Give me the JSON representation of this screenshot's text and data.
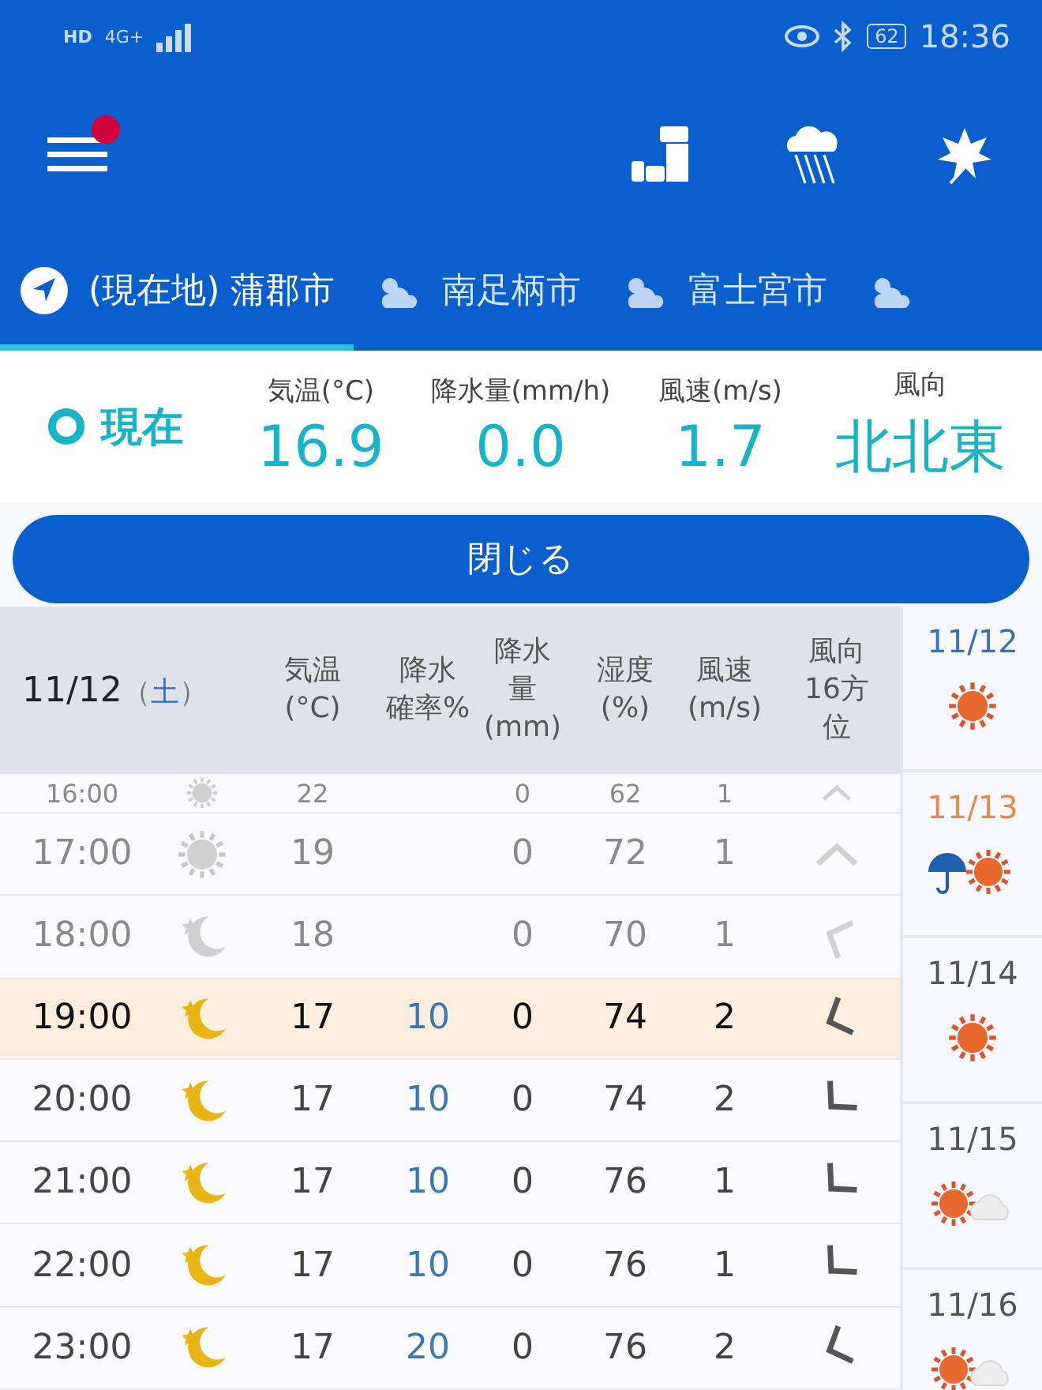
{
  "status_bar": {
    "left": [
      "HD",
      "4G+"
    ],
    "battery": "62",
    "time": "18:36"
  },
  "toolbar": {
    "menu_badge": true
  },
  "tabs": [
    {
      "label": "(現在地) 蒲郡市",
      "kind": "location",
      "selected": true
    },
    {
      "label": "南足柄市",
      "kind": "weather",
      "selected": false
    },
    {
      "label": "富士宮市",
      "kind": "weather",
      "selected": false
    },
    {
      "kind": "weather",
      "selected": false
    }
  ],
  "current": {
    "label": "現在",
    "fields": [
      {
        "label": "気温(°C)",
        "value": "16.9"
      },
      {
        "label": "降水量(mm/h)",
        "value": "0.0"
      },
      {
        "label": "風速(m/s)",
        "value": "1.7"
      },
      {
        "label": "風向",
        "value": "北北東"
      }
    ]
  },
  "close_button": "閉じる",
  "table": {
    "date": "11/12",
    "weekday_open": "（",
    "weekday": "土",
    "weekday_close": "）",
    "columns": [
      [
        "気温",
        "(°C)"
      ],
      [
        "降水",
        "確率%"
      ],
      [
        "降水",
        "量",
        "(mm)"
      ],
      [
        "湿度",
        "(%)"
      ],
      [
        "風速",
        "(m/s)"
      ],
      [
        "風向",
        "16方",
        "位"
      ]
    ],
    "rows": [
      {
        "time": "16:00",
        "kind": "sun",
        "temp": "22",
        "rain_amount": "0",
        "humidity": "62",
        "wind": "1",
        "wind_dir": {
          "kind": "n"
        },
        "past": true,
        "selected": false
      },
      {
        "time": "17:00",
        "kind": "sun",
        "temp": "19",
        "rain_amount": "0",
        "humidity": "72",
        "wind": "1",
        "wind_dir": {
          "kind": "n"
        },
        "past": true,
        "selected": false
      },
      {
        "time": "18:00",
        "kind": "moon",
        "temp": "18",
        "rain_amount": "0",
        "humidity": "70",
        "wind": "1",
        "wind_dir": {
          "kind": "wnw"
        },
        "past": true,
        "selected": false
      },
      {
        "time": "19:00",
        "kind": "moon",
        "temp": "17",
        "rain_prob": "10",
        "rain_amount": "0",
        "humidity": "74",
        "wind": "2",
        "wind_dir": {
          "kind": "wsw"
        },
        "past": false,
        "selected": true
      },
      {
        "time": "20:00",
        "kind": "moon",
        "temp": "17",
        "rain_prob": "10",
        "rain_amount": "0",
        "humidity": "74",
        "wind": "2",
        "wind_dir": {
          "kind": "sw"
        },
        "past": false,
        "selected": false
      },
      {
        "time": "21:00",
        "kind": "moon",
        "temp": "17",
        "rain_prob": "10",
        "rain_amount": "0",
        "humidity": "76",
        "wind": "1",
        "wind_dir": {
          "kind": "sw"
        },
        "past": false,
        "selected": false
      },
      {
        "time": "22:00",
        "kind": "moon",
        "temp": "17",
        "rain_prob": "10",
        "rain_amount": "0",
        "humidity": "76",
        "wind": "1",
        "wind_dir": {
          "kind": "sw"
        },
        "past": false,
        "selected": false
      },
      {
        "time": "23:00",
        "kind": "moon",
        "temp": "17",
        "rain_prob": "20",
        "rain_amount": "0",
        "humidity": "76",
        "wind": "2",
        "wind_dir": {
          "kind": "wsw"
        },
        "past": false,
        "selected": false
      }
    ]
  },
  "days": [
    {
      "date": "11/12",
      "color": "#3d6fb5",
      "kind": "sun"
    },
    {
      "date": "11/13",
      "color": "#e8884a",
      "kind": "umbrella"
    },
    {
      "date": "11/14",
      "color": "#555555",
      "kind": "sun"
    },
    {
      "date": "11/15",
      "color": "#555555",
      "kind": "cloudy"
    },
    {
      "date": "11/16",
      "color": "#555555",
      "kind": "cloudy"
    }
  ]
}
